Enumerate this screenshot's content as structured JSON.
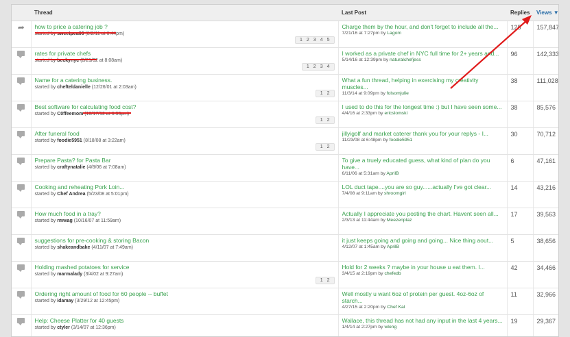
{
  "header": {
    "thread": "Thread",
    "last_post": "Last Post",
    "replies": "Replies",
    "views": "Views ▼"
  },
  "rows": [
    {
      "icon": "moved-thread-icon",
      "title": "how to price a catering job ?",
      "started_by": "started by",
      "author": "sweetpea06",
      "date": "(8/2/11 at 6:44pm)",
      "pages": [
        "1",
        "2",
        "3",
        "4",
        "5"
      ],
      "last_text": "Charge them by the hour, and don't forget to include all the...",
      "last_date": "7/21/16 at 7:27pm by",
      "last_user": "Lagom",
      "replies": "125",
      "views": "157,847"
    },
    {
      "icon": "thread-bubble-icon",
      "title": "rates for private chefs",
      "started_by": "started by",
      "author": "beckynyc",
      "date": "(8/21/02 at 8:08am)",
      "pages": [
        "1",
        "2",
        "3",
        "4"
      ],
      "last_text": "I worked as a private chef in NYC full time for 2+ years and...",
      "last_date": "5/14/16 at 12:39pm by",
      "last_user": "naturalchefjess",
      "replies": "96",
      "views": "142,333"
    },
    {
      "icon": "thread-bubble-icon",
      "title": "Name for a catering business.",
      "started_by": "started by",
      "author": "chefteldanielle",
      "date": "(12/26/01 at 2:03am)",
      "pages": [
        "1",
        "2"
      ],
      "last_text": "What a fun thread, helping in exercising my creativity muscles...",
      "last_date": "11/3/14 at 9:09pm by",
      "last_user": "folsomjulie",
      "replies": "38",
      "views": "111,028"
    },
    {
      "icon": "thread-bubble-icon",
      "title": "Best software for calculating food cost?",
      "started_by": "started by",
      "author": "C0ffeemom",
      "date": "(10/17/12 at 6:33pm)",
      "pages": [
        "1",
        "2"
      ],
      "last_text": "I used to do this for the longest time :) but I have seen some...",
      "last_date": "4/4/16 at 2:33pm by",
      "last_user": "ericslomski",
      "replies": "38",
      "views": "85,576"
    },
    {
      "icon": "thread-bubble-icon",
      "title": "After funeral food",
      "started_by": "started by",
      "author": "foodie5951",
      "date": "(8/18/08 at 3:22am)",
      "pages": [
        "1",
        "2"
      ],
      "last_text": "jillyigolf and market caterer thank you for your replys - I...",
      "last_date": "11/23/08 at 6:48pm by",
      "last_user": "foodie5951",
      "replies": "30",
      "views": "70,712"
    },
    {
      "icon": "thread-bubble-icon",
      "title": "Prepare Pasta? for Pasta Bar",
      "started_by": "started by",
      "author": "craftynatalie",
      "date": "(4/8/06 at 7:08am)",
      "pages": [],
      "last_text": "To give a truely educated guess, what kind of plan do you have...",
      "last_date": "6/11/06 at 5:31am by",
      "last_user": "AprilB",
      "replies": "6",
      "views": "47,161"
    },
    {
      "icon": "thread-bubble-icon",
      "title": "Cooking and reheating Pork Loin...",
      "started_by": "started by",
      "author": "Chef Andrea",
      "date": "(5/23/08 at 5:01pm)",
      "pages": [],
      "last_text": "LOL duct tape....you are so guy......actually I've got clear...",
      "last_date": "7/4/08 at 9:11am by",
      "last_user": "shroomgirl",
      "replies": "14",
      "views": "43,216"
    },
    {
      "icon": "thread-bubble-icon",
      "title": "How much food in a tray?",
      "started_by": "started by",
      "author": "rmwag",
      "date": "(10/16/07 at 11:59am)",
      "pages": [],
      "last_text": "Actually I appreciate you posting the chart. Havent seen all...",
      "last_date": "2/3/13 at 11:44am by",
      "last_user": "Meezenplaz",
      "replies": "17",
      "views": "39,563"
    },
    {
      "icon": "thread-bubble-icon",
      "title": "suggestions for pre-cooking & storing Bacon",
      "started_by": "started by",
      "author": "shakeandbake",
      "date": "(4/11/07 at 7:49am)",
      "pages": [],
      "last_text": "it just keeps going and going and going... Nice thing aout...",
      "last_date": "4/12/07 at 1:45am by",
      "last_user": "AprilB",
      "replies": "5",
      "views": "38,656"
    },
    {
      "icon": "thread-bubble-icon",
      "title": "Holding mashed potatoes for service",
      "started_by": "started by",
      "author": "marmalady",
      "date": "(3/4/02 at 9:27am)",
      "pages": [
        "1",
        "2"
      ],
      "last_text": "Hold for 2 weeks  ?  maybe in your house  u eat them.  I...",
      "last_date": "3/4/15 at 2:19pm by",
      "last_user": "chefedb",
      "replies": "42",
      "views": "34,466"
    },
    {
      "icon": "thread-bubble-icon",
      "title": "Ordering right amount of food for 60 people -- buffet",
      "started_by": "started by",
      "author": "idamay",
      "date": "(3/29/12 at 12:45pm)",
      "pages": [],
      "last_text": "Well mostly u want 6oz of protein per guest. 4oz-6oz of starch...",
      "last_date": "4/27/15 at 2:20pm by",
      "last_user": "Chef Kal",
      "replies": "11",
      "views": "32,966"
    },
    {
      "icon": "thread-bubble-icon",
      "title": "Help: Cheese Platter for 40 guests",
      "started_by": "started by",
      "author": "ctyler",
      "date": "(3/14/07 at 12:36pm)",
      "pages": [],
      "last_text": "Wallace, this thread has not had any input in the last 4 years...",
      "last_date": "1/4/14 at 2:27pm by",
      "last_user": "wlong",
      "replies": "19",
      "views": "29,367"
    }
  ],
  "colors": {
    "link": "#39a24e",
    "annotation": "#e01b1b",
    "header_bg": "#efefef"
  }
}
